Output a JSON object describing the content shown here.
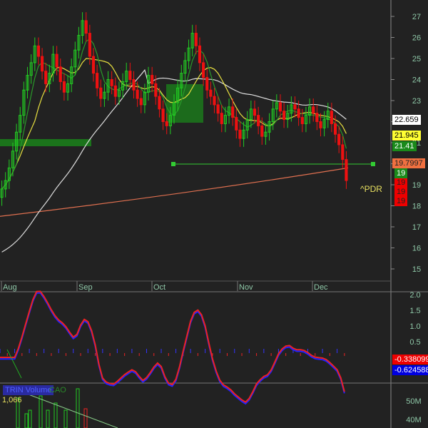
{
  "chart_data": {
    "type": "candlestick",
    "symbol_label": "^PDR",
    "x_tick_labels": [
      "Aug",
      "Sep",
      "Oct",
      "Nov",
      "Dec"
    ],
    "price_ticks": [
      15,
      16,
      17,
      18,
      19,
      20,
      21,
      22,
      23,
      24,
      25,
      26,
      27
    ],
    "closes": [
      18.8,
      19.2,
      19.8,
      20.6,
      21.5,
      22.3,
      23.5,
      24.2,
      24.8,
      25.6,
      25.1,
      24.4,
      23.8,
      24.3,
      25.2,
      24.6,
      23.9,
      23.4,
      23.8,
      24.6,
      25.4,
      26.1,
      26.8,
      26.2,
      25.1,
      24.3,
      23.6,
      23.1,
      23.4,
      24.0,
      23.7,
      23.2,
      23.5,
      23.9,
      24.4,
      24.0,
      23.5,
      23.1,
      22.8,
      23.4,
      24.2,
      23.8,
      23.2,
      22.6,
      22.0,
      21.8,
      22.3,
      22.9,
      23.6,
      24.3,
      24.9,
      25.5,
      26.2,
      25.6,
      24.8,
      24.1,
      23.5,
      23.2,
      22.8,
      22.4,
      21.9,
      22.3,
      22.7,
      22.2,
      21.6,
      21.2,
      21.6,
      22.1,
      22.6,
      22.3,
      21.8,
      21.3,
      21.5,
      22.0,
      22.6,
      22.9,
      22.5,
      22.1,
      22.4,
      22.8,
      22.6,
      22.2,
      21.9,
      22.3,
      22.7,
      22.4,
      22.0,
      21.7,
      22.1,
      22.5,
      21.9,
      21.4,
      20.9,
      20.2,
      19.2
    ],
    "series_labels": {
      "ma_white": "22.659",
      "ma_yellow": "21.945",
      "ma_green": "21.41",
      "ma_orange": "19.7997",
      "last_green": "19",
      "last_red": [
        "19",
        "19",
        "19"
      ]
    },
    "macd": {
      "ticks": [
        "2.0",
        "1.5",
        "1.0",
        "0.5",
        "0.0"
      ],
      "macd_value": "-0.3380999",
      "signal_value": "-0.624588"
    },
    "volume": {
      "legend": [
        "TRIN Volume",
        "CAO"
      ],
      "value": "1,066",
      "ticks": [
        "50M",
        "40M"
      ]
    }
  }
}
